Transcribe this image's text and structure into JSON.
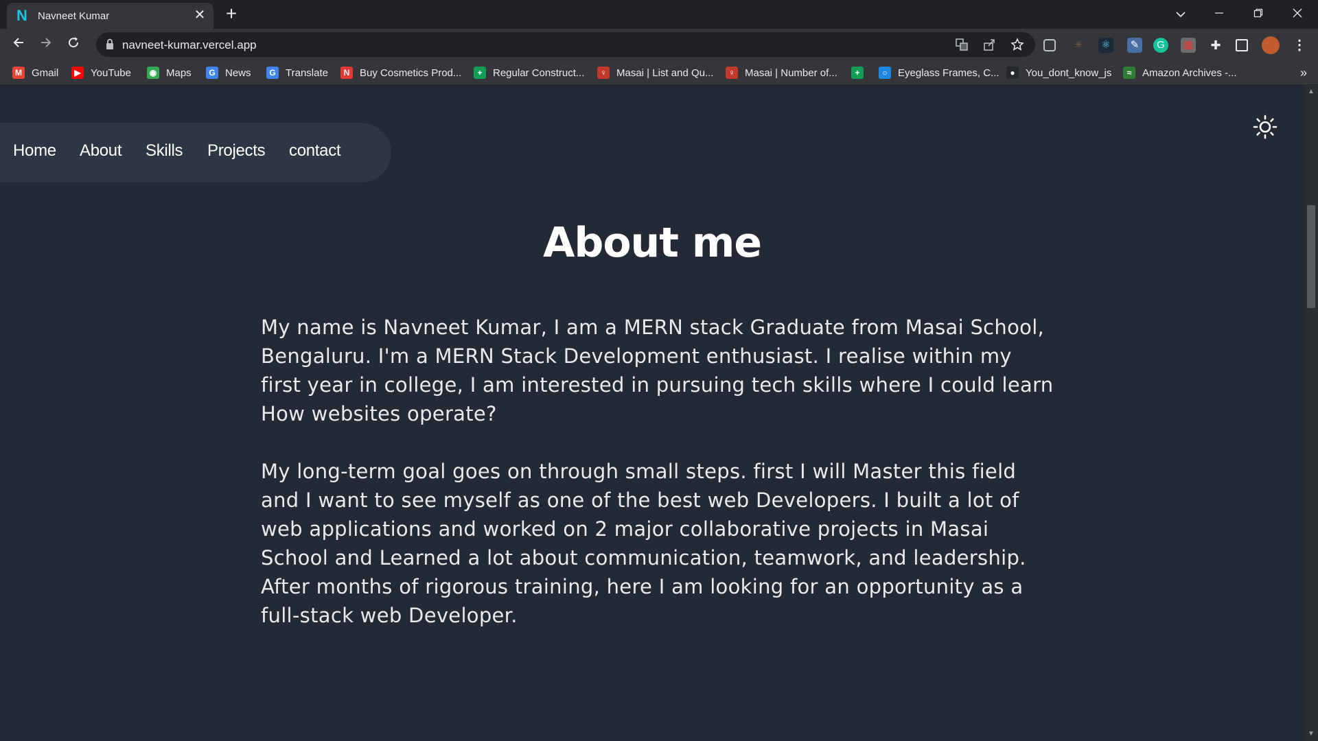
{
  "browser": {
    "tab_title": "Navneet Kumar",
    "tab_favicon": "N",
    "tab_close": "✕",
    "new_tab": "+",
    "url": "navneet-kumar.vercel.app",
    "bookmarks": [
      {
        "label": "Gmail",
        "icon": "gmail-icon",
        "color": "#ea4335",
        "glyph": "M"
      },
      {
        "label": "YouTube",
        "icon": "youtube-icon",
        "color": "#ff0000",
        "glyph": "▶"
      },
      {
        "label": "Maps",
        "icon": "maps-icon",
        "color": "#34a853",
        "glyph": "◉"
      },
      {
        "label": "News",
        "icon": "news-icon",
        "color": "#4285f4",
        "glyph": "G"
      },
      {
        "label": "Translate",
        "icon": "translate-icon",
        "color": "#4285f4",
        "glyph": "G"
      },
      {
        "label": "Buy Cosmetics Prod...",
        "icon": "cosmetics-icon",
        "color": "#e53935",
        "glyph": "N"
      },
      {
        "label": "Regular Construct...",
        "icon": "sheets-icon",
        "color": "#0f9d58",
        "glyph": "+"
      },
      {
        "label": "Masai | List and Qu...",
        "icon": "masai-icon",
        "color": "#c0392b",
        "glyph": "♀"
      },
      {
        "label": "Masai | Number of...",
        "icon": "masai-icon",
        "color": "#c0392b",
        "glyph": "♀"
      },
      {
        "label": "",
        "icon": "sheets-icon",
        "color": "#0f9d58",
        "glyph": "+"
      },
      {
        "label": "Eyeglass Frames, C...",
        "icon": "eyeglass-icon",
        "color": "#1e88e5",
        "glyph": "○"
      },
      {
        "label": "You_dont_know_js",
        "icon": "github-icon",
        "color": "#24292e",
        "glyph": "●"
      },
      {
        "label": "Amazon Archives -...",
        "icon": "amazon-icon",
        "color": "#2e7d32",
        "glyph": "≈"
      }
    ],
    "bookmarks_overflow": "»"
  },
  "page": {
    "nav": [
      "Home",
      "About",
      "Skills",
      "Projects",
      "contact"
    ],
    "title": "About me",
    "paragraphs": [
      "My name is Navneet Kumar, I am a MERN stack Graduate from Masai School, Bengaluru. I'm a MERN Stack Development enthusiast. I realise within my first year in college, I am interested in pursuing tech skills where I could learn How websites operate?",
      "My long-term goal goes on through small steps. first I will Master this field and I want to see myself as one of the best web Developers. I built a lot of web applications and worked on 2 major collaborative projects in Masai School and Learned a lot about communication, teamwork, and leadership. After months of rigorous training, here I am looking for an opportunity as a full-stack web Developer."
    ]
  },
  "colors": {
    "page_bg": "#242a35",
    "nav_pill": "#2e3643",
    "chrome_dark": "#202124",
    "chrome_light": "#35363a",
    "favicon": "#16c7e6"
  }
}
